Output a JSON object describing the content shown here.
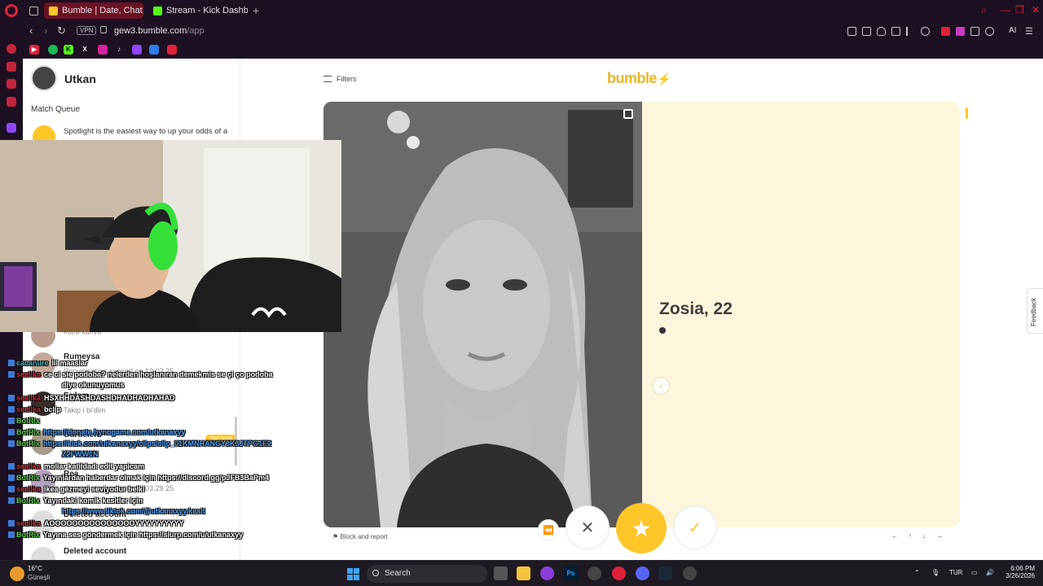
{
  "browser": {
    "tabs": [
      {
        "label": "Bumble | Date, Chat, Meet",
        "active": true
      },
      {
        "label": "Stream - Kick Dashboard",
        "active": false
      }
    ],
    "vpn_label": "VPN",
    "url_host": "gew3.bumble.com",
    "url_path": "/app",
    "ai_label": "AI",
    "colors": {
      "accent": "#e0213c",
      "chrome": "#1c1022",
      "active_tab": "#6b1322"
    }
  },
  "bumble": {
    "user_name": "Utkan",
    "match_queue_label": "Match Queue",
    "spotlight_text": "Spotlight is the easiest way to up your odds of a",
    "filters_label": "Filters",
    "logo_text": "bumble",
    "profile_name": "Zosia, 22",
    "block_report_label": "Block and report",
    "your_move_label": "Your move",
    "feedback_label": "Feedback",
    "keyboard_hints": [
      "←",
      "↑",
      "↓",
      "→"
    ],
    "conversations": [
      {
        "name": "Rumeysa",
        "subtitle": "Conversation expired on 12.03.25"
      },
      {
        "name": "Erdem",
        "subtitle": "Takip i bi'dim"
      },
      {
        "name": "Gardelen",
        "subtitle": ""
      },
      {
        "name": "Rea",
        "subtitle": "Conversation expired on 03.29.25"
      },
      {
        "name": "Deleted account",
        "subtitle": ""
      },
      {
        "name": "Deleted account",
        "subtitle": ""
      }
    ],
    "partial_subtitle": "Filtre kahve",
    "colors": {
      "brand": "#ffc629",
      "card_bg": "#fef6dc"
    }
  },
  "chat": [
    {
      "user": "cacanure",
      "color": "#3bb4c4",
      "text": "lil maaslar",
      "link": false
    },
    {
      "user": "seelika",
      "color": "#d12a3a",
      "text": "ce ci sie podoba? nelerden hoşlanıran demekmis se çi ço podoba",
      "link": false
    },
    {
      "user": "",
      "color": "#fff",
      "text": "diye okunuyomus",
      "link": false
    },
    {
      "user": "seelika",
      "color": "#d12a3a",
      "text": "HSXHHDASHDASHDHADHADHAHAD",
      "link": false
    },
    {
      "user": "seelika",
      "color": "#d12a3a",
      "text": "bclip",
      "link": false
    },
    {
      "user": "BotRix",
      "color": "#5bd14e",
      "text": "https://donate.bynogame.com/utkanaxyy",
      "link": true
    },
    {
      "user": "BotRix",
      "color": "#5bd14e",
      "text": "https://kick.com/utkanaxyy/clips/clip_01KMNHANGY3K3JTPG1E2",
      "link": true
    },
    {
      "user": "",
      "color": "#fff",
      "text": "Z2FWW1N",
      "link": true
    },
    {
      "user": "seelika",
      "color": "#d12a3a",
      "text": "moliar katildadı edit yapicam",
      "link": false
    },
    {
      "user": "BotRix",
      "color": "#5bd14e",
      "text": "Yayınlardan haberdar olmak için https://discord.gg/pJFB3BaPm4",
      "link": false
    },
    {
      "user": "seelika",
      "color": "#d12a3a",
      "text": "ikea gezmeyi seviyodur belki",
      "link": false
    },
    {
      "user": "BotRix",
      "color": "#5bd14e",
      "text": "Yayındaki komik kesitler için",
      "link": false
    },
    {
      "user": "",
      "color": "#fff",
      "text": "https://www.tiktok.com/@utkanaxyy.kesit",
      "link": true
    },
    {
      "user": "seelika",
      "color": "#d12a3a",
      "text": "AOOOOOOOOOOOOOOOYYYYYYYYYY",
      "link": false
    },
    {
      "user": "BotRix",
      "color": "#5bd14e",
      "text": "Yayına ses göndermek için https://slurp.com/u/utkanaxyy",
      "link": false
    }
  ],
  "taskbar": {
    "temperature": "16°C",
    "city": "Güneşli",
    "search_label": "Search",
    "language": "TUR",
    "time": "6:06 PM",
    "date": "3/26/2026",
    "notif_count": "1"
  }
}
